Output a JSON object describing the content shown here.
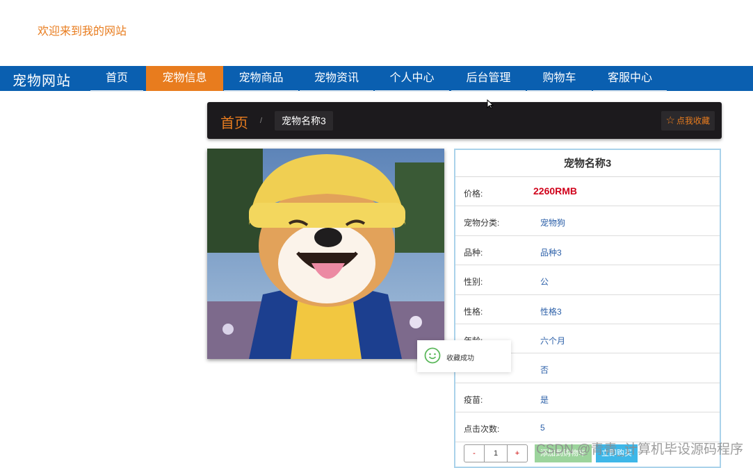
{
  "header": {
    "welcome": "欢迎来到我的网站"
  },
  "nav": {
    "brand": "宠物网站",
    "items": [
      {
        "label": "首页",
        "active": false
      },
      {
        "label": "宠物信息",
        "active": true
      },
      {
        "label": "宠物商品",
        "active": false
      },
      {
        "label": "宠物资讯",
        "active": false
      },
      {
        "label": "个人中心",
        "active": false
      },
      {
        "label": "后台管理",
        "active": false
      },
      {
        "label": "购物车",
        "active": false
      },
      {
        "label": "客服中心",
        "active": false
      }
    ]
  },
  "breadcrumb": {
    "home": "首页",
    "separator": "/",
    "current": "宠物名称3",
    "favorite": "点我收藏"
  },
  "pet": {
    "name": "宠物名称3",
    "price_label": "价格:",
    "price": "2260RMB",
    "fields": [
      {
        "label": "宠物分类:",
        "value": "宠物狗"
      },
      {
        "label": "品种:",
        "value": "品种3"
      },
      {
        "label": "性别:",
        "value": "公"
      },
      {
        "label": "性格:",
        "value": "性格3"
      },
      {
        "label": "年龄:",
        "value": "六个月"
      },
      {
        "label": "",
        "value": "否"
      },
      {
        "label": "疫苗:",
        "value": "是"
      },
      {
        "label": "点击次数:",
        "value": "5"
      }
    ]
  },
  "purchase": {
    "minus": "-",
    "quantity": "1",
    "plus": "+",
    "add_to_cart": "添加到购物车",
    "buy_now": "立即购买"
  },
  "toast": {
    "message": "收藏成功"
  },
  "watermark": "CSDN @青青_计算机毕设源码程序",
  "colors": {
    "brand_blue": "#0a5fb0",
    "accent_orange": "#e87c1e",
    "price_red": "#d0021b"
  }
}
